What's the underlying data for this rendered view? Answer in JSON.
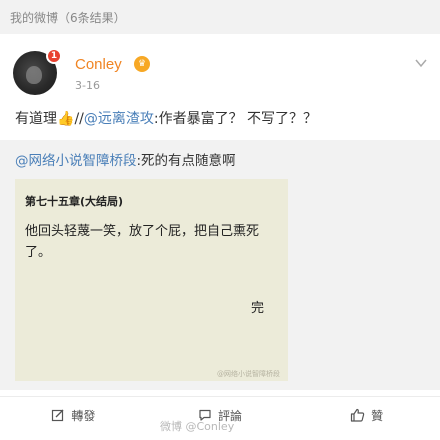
{
  "top_bar": {
    "title": "我的微博（6条结果）"
  },
  "post": {
    "author": "Conley",
    "avatar_badge": "1",
    "vip_glyph": "♛",
    "time": "3-16",
    "text": {
      "prefix": "有道理",
      "emoji": "👍",
      "slashes": "//",
      "mention": "@远离渣攻",
      "rest": ":作者暴富了？ 不写了？？"
    }
  },
  "repost": {
    "mention": "@网络小说智障桥段",
    "text": ":死的有点随意啊",
    "image": {
      "chapter_title": "第七十五章(大结局)",
      "body": "他回头轻蔑一笑，放了个屁，把自己熏死了。",
      "end_mark": "完",
      "watermark": "@网络小说智障桥段"
    }
  },
  "actions": {
    "repost_label": "轉發",
    "comment_label": "評論",
    "like_label": "贊"
  },
  "footer_watermark": "微博 @Conley",
  "colors": {
    "username": "#f08524",
    "link": "#4a7fb8",
    "badge": "#e8412f"
  }
}
